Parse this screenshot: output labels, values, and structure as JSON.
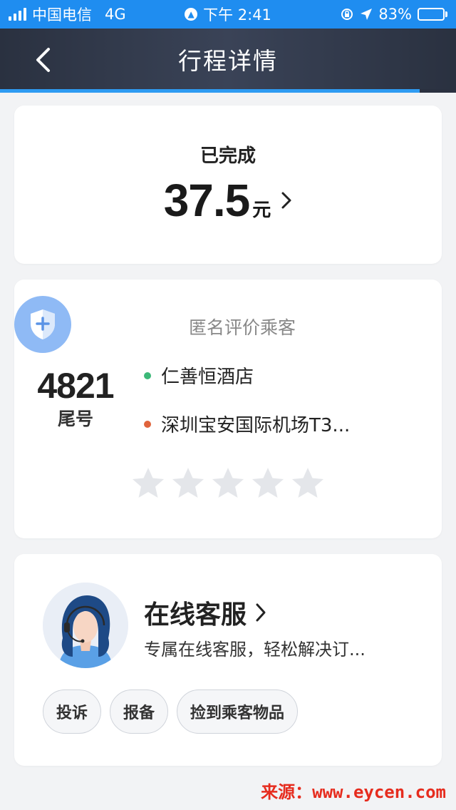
{
  "status_bar": {
    "carrier": "中国电信",
    "network": "4G",
    "time": "下午 2:41",
    "battery": "83%",
    "battery_level": 0.83
  },
  "header": {
    "title": "行程详情",
    "progress": 0.92
  },
  "fare": {
    "status": "已完成",
    "amount": "37.5",
    "unit": "元"
  },
  "trip": {
    "rate_title": "匿名评价乘客",
    "tail_number": "4821",
    "tail_label": "尾号",
    "start": "仁善恒酒店",
    "end": "深圳宝安国际机场T3...",
    "start_color": "#3cb878",
    "end_color": "#e0643c",
    "rating_max": 5,
    "rating": 0
  },
  "service": {
    "title": "在线客服",
    "description": "专属在线客服，轻松解决订...",
    "chips": [
      "投诉",
      "报备",
      "捡到乘客物品"
    ]
  },
  "watermark": "来源：www.eycen.com",
  "colors": {
    "accent": "#1f8df0",
    "header_bg": "#2f3646",
    "star_empty": "#e4e6ea"
  }
}
